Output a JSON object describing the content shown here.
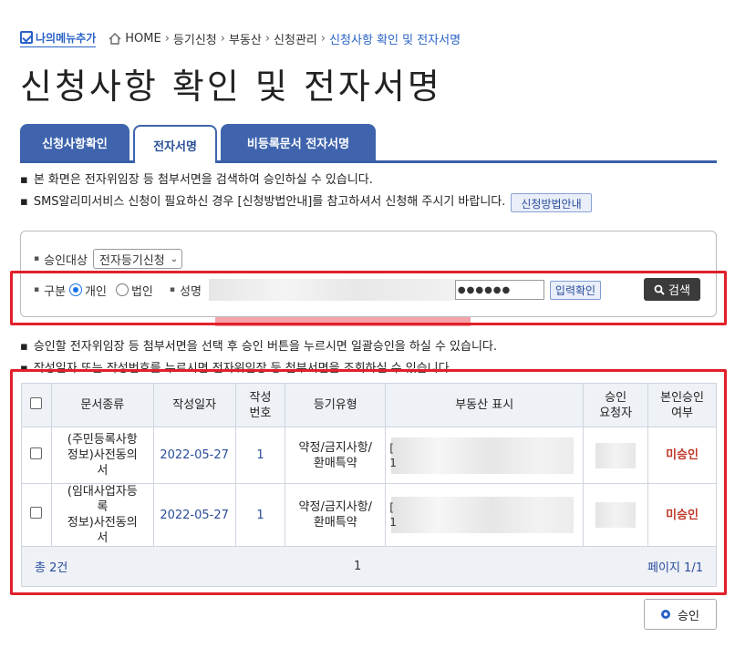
{
  "topbar": {
    "my_menu": "나의메뉴추가",
    "crumbs": [
      "HOME",
      "등기신청",
      "부동산",
      "신청관리"
    ],
    "current": "신청사항 확인 및 전자서명"
  },
  "page_title": "신청사항 확인 및 전자서명",
  "tabs": [
    {
      "label": "신청사항확인",
      "active": false
    },
    {
      "label": "전자서명",
      "active": true
    },
    {
      "label": "비등록문서 전자서명",
      "active": false
    }
  ],
  "notes_top": [
    "본 화면은 전자위임장 등 첨부서면을 검색하여 승인하실 수 있습니다.",
    "SMS알리미서비스 신청이 필요하신 경우 [신청방법안내]를 참고하셔서 신청해 주시기 바랍니다."
  ],
  "guide_button": "신청방법안내",
  "search": {
    "target_label": "승인대상",
    "target_value": "전자등기신청",
    "division_label": "구분",
    "radio_individual": "개인",
    "radio_corporate": "법인",
    "name_label": "성명",
    "password_mask": "●●●●●●",
    "confirm_button": "입력확인",
    "search_button": "검색"
  },
  "notes_bottom": [
    "승인할 전자위임장 등 첨부서면을 선택 후 승인 버튼을 누르시면 일괄승인을 하실 수 있습니다.",
    "작성일자 또는 작성번호를 누르시면 전자위임장 등 첨부서면을 조회하실 수 있습니다."
  ],
  "table": {
    "headers": [
      "문서종류",
      "작성일자",
      "작성\n번호",
      "등기유형",
      "부동산 표시",
      "승인\n요청자",
      "본인승인\n여부"
    ],
    "rows": [
      {
        "doc": "(주민등록사항\n정보)사전동의\n서",
        "date": "2022-05-27",
        "num": "1",
        "type": "약정/금지사항/\n환매특약",
        "addr": "[\n1",
        "status": "미승인"
      },
      {
        "doc": "(임대사업자등\n록\n정보)사전동의\n서",
        "date": "2022-05-27",
        "num": "1",
        "type": "약정/금지사항/\n환매특약",
        "addr": "[\n1",
        "status": "미승인"
      }
    ]
  },
  "footer": {
    "total": "총 2건",
    "page_index": "1",
    "page_label": "페이지 1/1"
  },
  "approve_button": "승인"
}
